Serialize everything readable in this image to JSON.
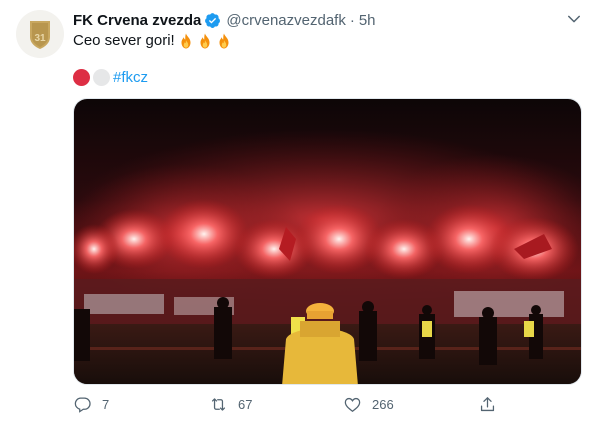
{
  "account": {
    "name": "FK Crvena zvezda",
    "handle": "@crvenazvezdafk",
    "separator": "·",
    "time": "5h",
    "avatar_number": "31"
  },
  "tweet": {
    "text": "Ceo sever gori!",
    "emoji_icon": "fire-emoji",
    "emoji_count": 3,
    "hashtag": "#fkcz",
    "flag_circles": [
      "red-circle",
      "white-circle"
    ]
  },
  "actions": {
    "reply_count": "7",
    "retweet_count": "67",
    "like_count": "266"
  },
  "colors": {
    "accent": "#1d9bf0",
    "verified": "#1d9bf0",
    "muted": "#536471"
  }
}
